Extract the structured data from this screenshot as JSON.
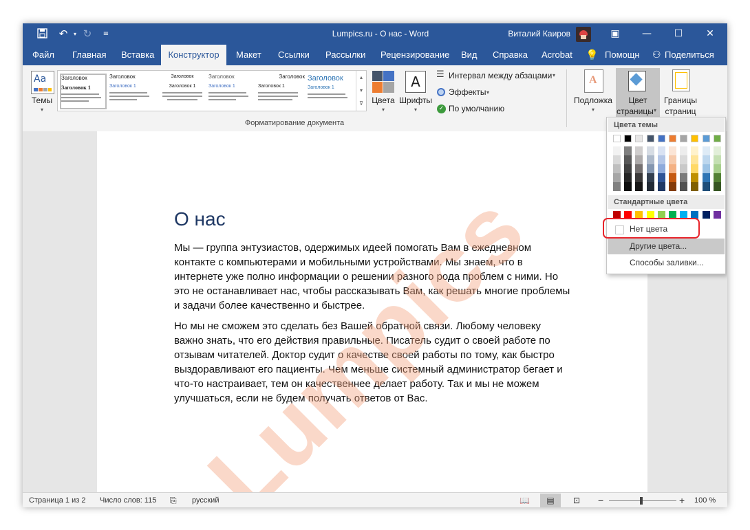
{
  "window": {
    "title": "Lumpics.ru - О нас - Word",
    "user": "Виталий Каиров"
  },
  "quick_access": {
    "save_icon": "save-icon",
    "undo_icon": "undo-icon",
    "redo_icon": "redo-icon",
    "customize_icon": "customize-icon"
  },
  "tabs": [
    {
      "label": "Файл",
      "active": false
    },
    {
      "label": "Главная",
      "active": false
    },
    {
      "label": "Вставка",
      "active": false
    },
    {
      "label": "Конструктор",
      "active": true
    },
    {
      "label": "Макет",
      "active": false
    },
    {
      "label": "Ссылки",
      "active": false
    },
    {
      "label": "Рассылки",
      "active": false
    },
    {
      "label": "Рецензирование",
      "active": false
    },
    {
      "label": "Вид",
      "active": false
    },
    {
      "label": "Справка",
      "active": false
    },
    {
      "label": "Acrobat",
      "active": false
    }
  ],
  "tell_me": "Помощн",
  "share": "Поделиться",
  "ribbon": {
    "themes_label": "Темы",
    "gallery_items": [
      {
        "heading": "Заголовок",
        "subheading": "Заголовок 1"
      },
      {
        "heading": "Заголовок",
        "subheading": "Заголовок 1"
      },
      {
        "heading": "Заголовок",
        "subheading": "Заголовок 1"
      },
      {
        "heading": "Заголовок",
        "subheading": "Заголовок 1"
      },
      {
        "heading": "Заголовок",
        "subheading": "Заголовок 1"
      },
      {
        "heading": "Заголовок",
        "subheading": "Заголовок 1"
      }
    ],
    "colors_label": "Цвета",
    "fonts_label": "Шрифты",
    "paragraph_spacing": "Интервал между абзацами",
    "effects": "Эффекты",
    "set_default": "По умолчанию",
    "group_label": "Форматирование документа",
    "watermark_label": "Подложка",
    "page_color_label_1": "Цвет",
    "page_color_label_2": "страницы",
    "page_borders_label_1": "Границы",
    "page_borders_label_2": "страниц"
  },
  "document": {
    "title": "О нас",
    "paragraph1_lines": [
      "Мы — группа энтузиастов, одержимых идеей помогать Вам в ежедневном",
      "контакте с компьютерами и мобильными устройствами. Мы знаем, что в",
      "интернете уже полно информации о решении разного рода проблем с ними. Но",
      "это не останавливает нас, чтобы рассказывать Вам, как решать многие проблемы",
      "и задачи более качественно и быстрее."
    ],
    "paragraph2_lines": [
      "Но мы не сможем это сделать без Вашей обратной связи. Любому человеку",
      "важно знать, что его действия правильные. Писатель судит о своей работе по",
      "отзывам читателей. Доктор судит о качестве своей работы по тому, как быстро",
      "выздоравливают его пациенты. Чем меньше системный администратор бегает и",
      "что-то настраивает, тем он качественнее делает работу. Так и мы не можем",
      "улучшаться, если не будем получать ответов от Вас."
    ],
    "watermark": "Lumpics"
  },
  "dropdown": {
    "theme_colors_header": "Цвета темы",
    "standard_colors_header": "Стандартные цвета",
    "theme_top": [
      "#ffffff",
      "#000000",
      "#e7e6e6",
      "#44546a",
      "#4472c4",
      "#ed7d31",
      "#a5a5a5",
      "#ffc000",
      "#5b9bd5",
      "#70ad47"
    ],
    "theme_shades": [
      [
        "#f2f2f2",
        "#d9d9d9",
        "#bfbfbf",
        "#a6a6a6",
        "#808080"
      ],
      [
        "#808080",
        "#595959",
        "#404040",
        "#262626",
        "#0d0d0d"
      ],
      [
        "#d0cece",
        "#aeabab",
        "#757171",
        "#3a3838",
        "#171616"
      ],
      [
        "#d6dce4",
        "#adb9ca",
        "#8496b0",
        "#333f4f",
        "#222a35"
      ],
      [
        "#d9e2f3",
        "#b4c6e7",
        "#8eaadb",
        "#2f5496",
        "#1f3864"
      ],
      [
        "#fbe5d6",
        "#f7cbac",
        "#f4b183",
        "#c55a11",
        "#833c0b"
      ],
      [
        "#ededed",
        "#dbdbdb",
        "#c9c9c9",
        "#7b7b7b",
        "#525252"
      ],
      [
        "#fff2cc",
        "#ffe599",
        "#ffd966",
        "#bf9000",
        "#7f6000"
      ],
      [
        "#deebf6",
        "#bdd7ee",
        "#9cc3e5",
        "#2e75b5",
        "#1e4e79"
      ],
      [
        "#e2efd9",
        "#c5e0b3",
        "#a8d08d",
        "#538135",
        "#375623"
      ]
    ],
    "standard": [
      "#c00000",
      "#ff0000",
      "#ffc000",
      "#ffff00",
      "#92d050",
      "#00b050",
      "#00b0f0",
      "#0070c0",
      "#002060",
      "#7030a0"
    ],
    "no_color": "Нет цвета",
    "more_colors": "Другие цвета...",
    "fill_effects": "Способы заливки..."
  },
  "status": {
    "page": "Страница 1 из 2",
    "words": "Число слов: 115",
    "language": "русский",
    "zoom": "100 %",
    "zoom_minus": "−",
    "zoom_plus": "+"
  },
  "colors": {
    "accent": "#2b579a",
    "highlight": "#e8232a",
    "heading": "#1f3864",
    "watermark": "#f4a07a"
  }
}
